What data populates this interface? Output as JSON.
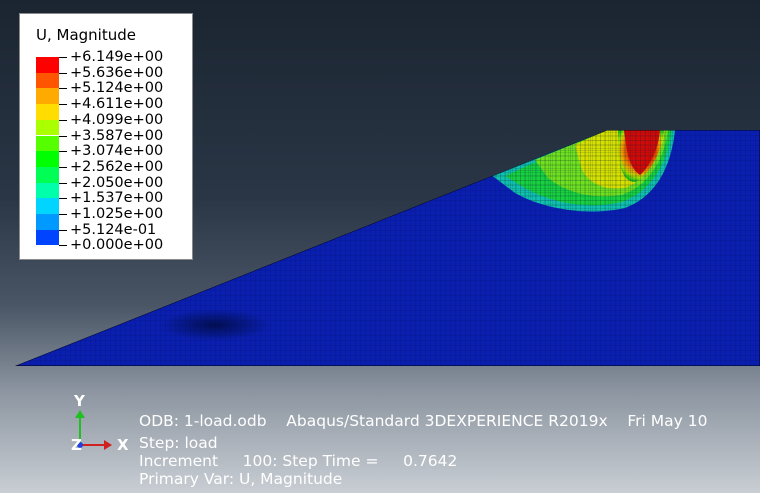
{
  "legend": {
    "title": "U, Magnitude",
    "labels": [
      "+6.149e+00",
      "+5.636e+00",
      "+5.124e+00",
      "+4.611e+00",
      "+4.099e+00",
      "+3.587e+00",
      "+3.074e+00",
      "+2.562e+00",
      "+2.050e+00",
      "+1.537e+00",
      "+1.025e+00",
      "+5.124e-01",
      "+0.000e+00"
    ],
    "colors": [
      "#ff0000",
      "#ff5500",
      "#ffaa00",
      "#ffdd00",
      "#aaff00",
      "#55ff00",
      "#00ff00",
      "#00ff55",
      "#00ffaa",
      "#00d5ff",
      "#0099ff",
      "#0044ff"
    ]
  },
  "triad": {
    "y": "Y",
    "x": "X",
    "z": "Z"
  },
  "info": {
    "odb_line": "ODB: 1-load.odb    Abaqus/Standard 3DEXPERIENCE R2019x    Fri May 10",
    "step_line": "Step: load",
    "increment_line": "Increment     100: Step Time =     0.7642",
    "primary_var_line": "Primary Var: U, Magnitude"
  },
  "mesh_colors": {
    "base": "#0a1fb0",
    "hot": "#e01010"
  }
}
